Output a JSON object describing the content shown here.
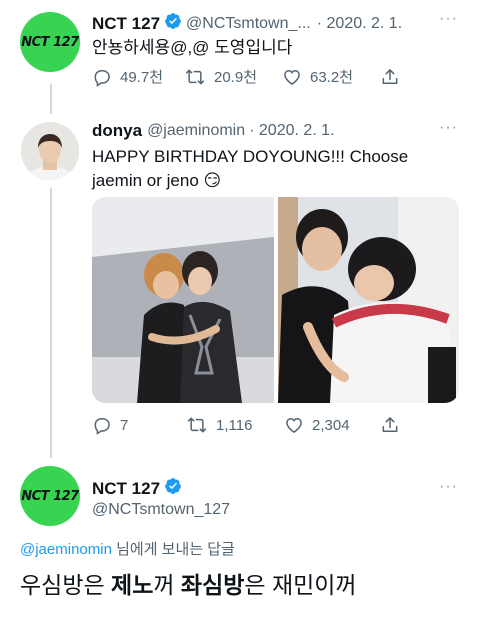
{
  "colors": {
    "accent": "#1d9bf0",
    "nct_green": "#39d352",
    "muted": "#536471"
  },
  "tweet1": {
    "avatar_text": "NCT 127",
    "name": "NCT 127",
    "handle": "@NCTsmtown_...",
    "date": "· 2020. 2. 1.",
    "more": "···",
    "text": "안뇽하세용@,@ 도영입니다",
    "replies": "49.7천",
    "retweets": "20.9천",
    "likes": "63.2천",
    "icons": [
      "reply-icon",
      "retweet-icon",
      "like-icon",
      "share-icon"
    ]
  },
  "tweet2": {
    "name": "donya",
    "handle": "@jaeminomin",
    "date": "· 2020. 2. 1.",
    "more": "···",
    "text_line1": "HAPPY BIRTHDAY DOYOUNG!!! Choose",
    "text_line2": "jaemin or jeno",
    "emoji": "😏",
    "replies": "7",
    "retweets": "1,116",
    "likes": "2,304"
  },
  "tweet3": {
    "avatar_text": "NCT 127",
    "name": "NCT 127",
    "handle": "@NCTsmtown_127",
    "more": "···",
    "reply_to_mention": "@jaeminomin",
    "reply_to_suffix": " 님에게 보내는 답글",
    "text_part1": "우심방은 ",
    "text_bold1": "제노",
    "text_part2": "꺼 ",
    "text_bold2": "좌심방",
    "text_part3": "은 재민이꺼"
  }
}
